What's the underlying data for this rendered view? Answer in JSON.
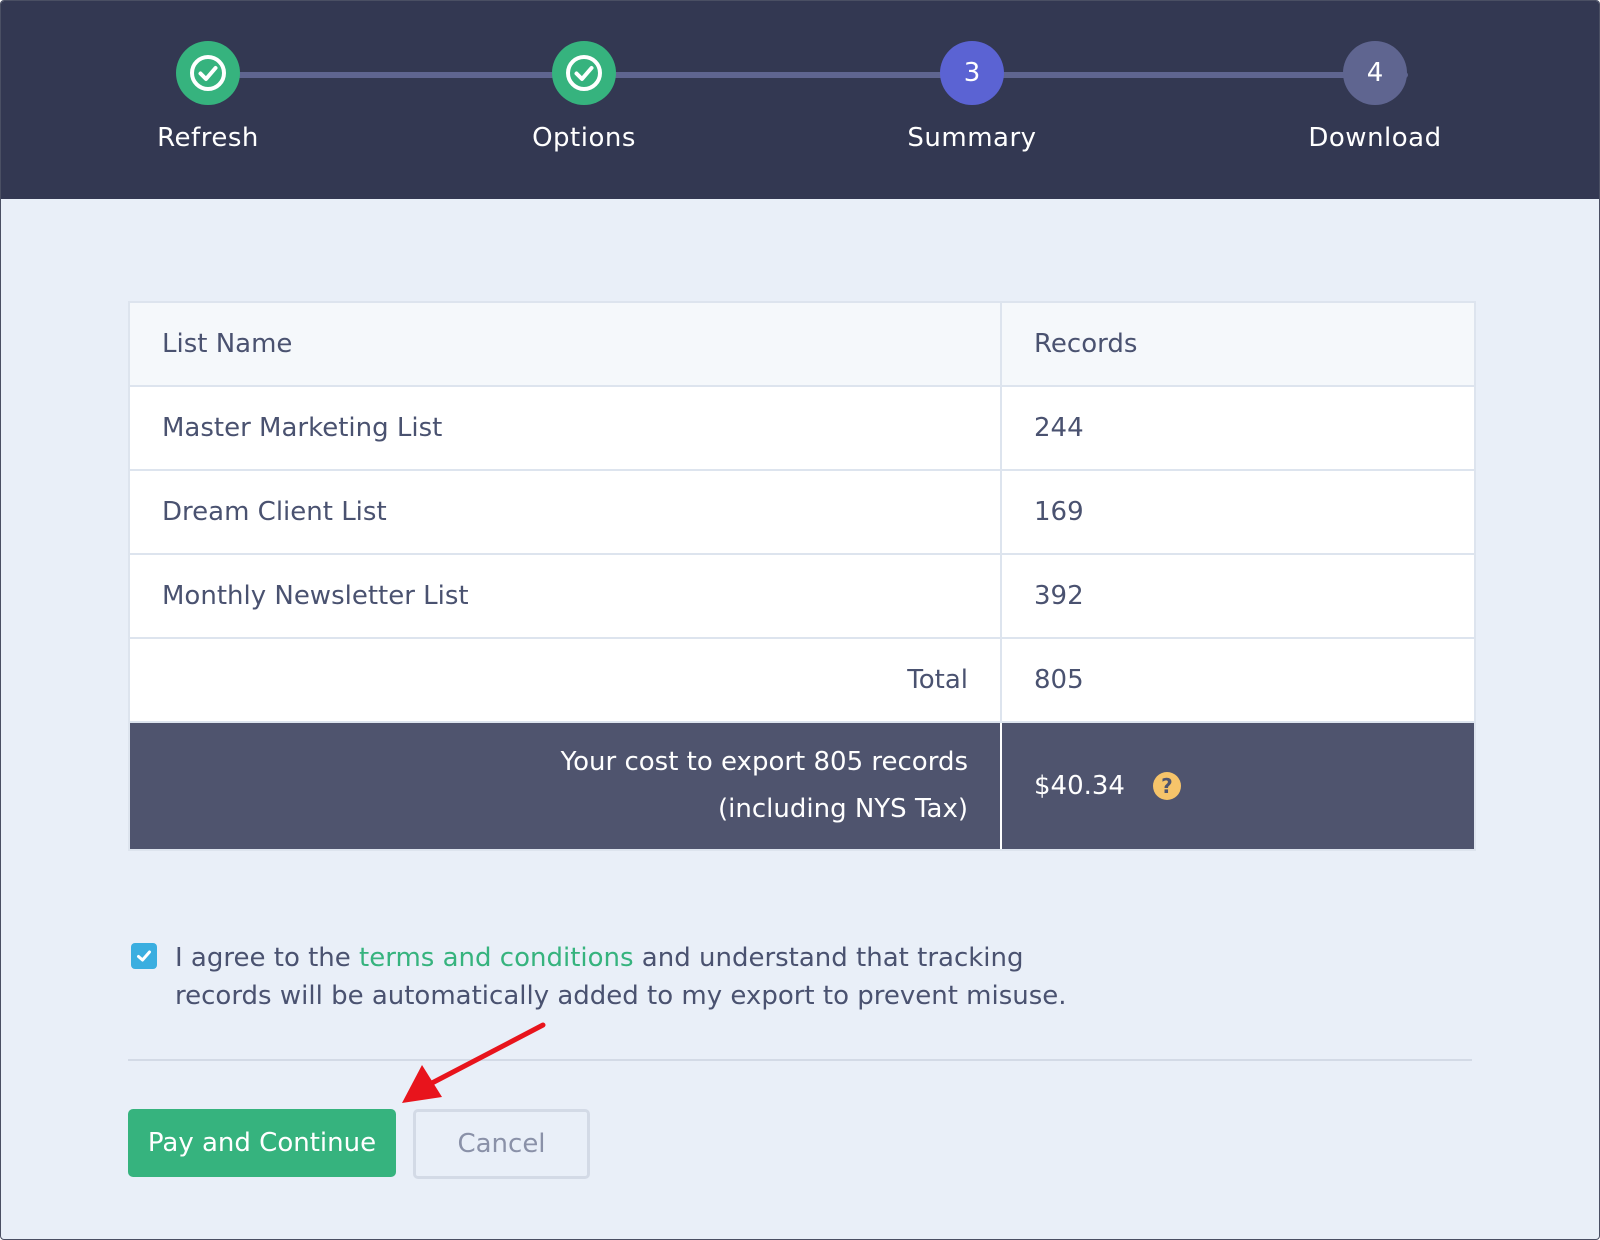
{
  "stepper": {
    "steps": [
      {
        "label": "Refresh",
        "state": "done",
        "icon": "check-circle-icon"
      },
      {
        "label": "Options",
        "state": "done",
        "icon": "check-circle-icon"
      },
      {
        "label": "Summary",
        "state": "current",
        "number": "3"
      },
      {
        "label": "Download",
        "state": "upcoming",
        "number": "4"
      }
    ]
  },
  "table": {
    "headers": {
      "list_name": "List Name",
      "records": "Records"
    },
    "rows": [
      {
        "name": "Master Marketing List",
        "records": "244"
      },
      {
        "name": "Dream Client List",
        "records": "169"
      },
      {
        "name": "Monthly Newsletter List",
        "records": "392"
      }
    ],
    "total_label": "Total",
    "total_value": "805",
    "cost_line1": "Your cost to export 805 records",
    "cost_line2": "(including NYS Tax)",
    "cost_value": "$40.34",
    "help_icon": "question-circle-icon"
  },
  "agreement": {
    "checked": true,
    "text_before": "I agree to the ",
    "link_text": "terms and conditions",
    "text_after": " and understand that tracking records will be automatically added to my export to prevent misuse."
  },
  "actions": {
    "primary_label": "Pay and Continue",
    "secondary_label": "Cancel"
  },
  "colors": {
    "header_bg": "#333852",
    "done": "#36b37e",
    "current": "#5b63d3",
    "upcoming": "#5f6590",
    "cost_row_bg": "#4f546e",
    "link": "#36b37e",
    "annotation_arrow": "#e8141c"
  }
}
